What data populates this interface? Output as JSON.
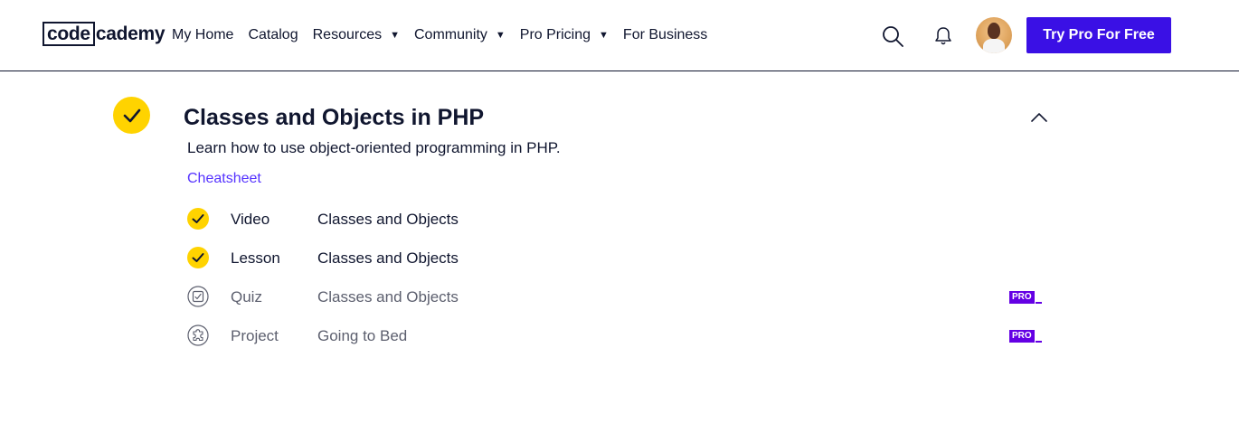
{
  "header": {
    "logo": {
      "part1": "code",
      "part2": "cademy"
    },
    "nav": [
      {
        "label": "My Home",
        "has_caret": false
      },
      {
        "label": "Catalog",
        "has_caret": false
      },
      {
        "label": "Resources",
        "has_caret": true
      },
      {
        "label": "Community",
        "has_caret": true
      },
      {
        "label": "Pro Pricing",
        "has_caret": true
      },
      {
        "label": "For Business",
        "has_caret": false
      }
    ],
    "caret_glyph": "▼",
    "cta_label": "Try Pro For Free",
    "icons": {
      "search": "search-icon",
      "notifications": "bell-icon",
      "avatar": "user-avatar"
    }
  },
  "module": {
    "title": "Classes and Objects in PHP",
    "description": "Learn how to use object-oriented programming in PHP.",
    "cheatsheet_label": "Cheatsheet",
    "completed": true,
    "items": [
      {
        "type": "Video",
        "title": "Classes and Objects",
        "status": "complete",
        "icon": "check-icon",
        "pro": false
      },
      {
        "type": "Lesson",
        "title": "Classes and Objects",
        "status": "complete",
        "icon": "check-icon",
        "pro": false
      },
      {
        "type": "Quiz",
        "title": "Classes and Objects",
        "status": "locked",
        "icon": "quiz-icon",
        "pro": true
      },
      {
        "type": "Project",
        "title": "Going to Bed",
        "status": "locked",
        "icon": "project-icon",
        "pro": true
      }
    ],
    "pro_label": "PRO"
  },
  "colors": {
    "brand_blue": "#3a10e5",
    "check_yellow": "#ffd300",
    "pro_purple": "#6400e4",
    "link_purple": "#5533ff",
    "text_dark": "#10162f"
  }
}
